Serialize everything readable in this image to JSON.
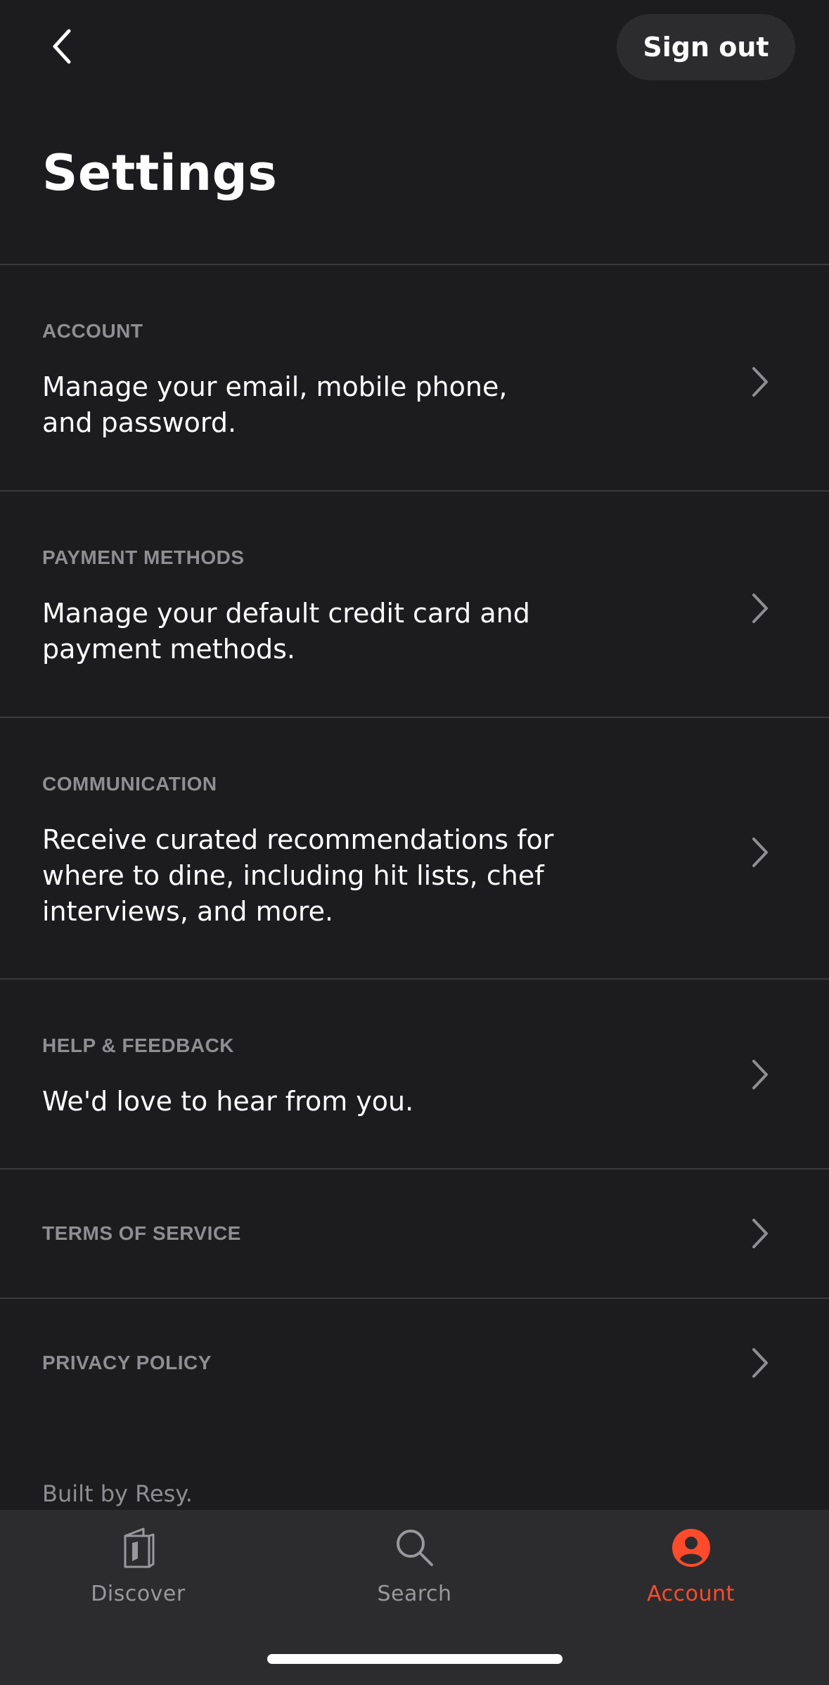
{
  "header": {
    "back_icon": "chevron-left-icon",
    "signout_label": "Sign out",
    "title": "Settings"
  },
  "settings": {
    "items": [
      {
        "label": "ACCOUNT",
        "description": "Manage your email, mobile phone, and password."
      },
      {
        "label": "PAYMENT METHODS",
        "description": "Manage your default credit card and payment methods."
      },
      {
        "label": "COMMUNICATION",
        "description": "Receive curated recommendations for where to dine, including hit lists, chef interviews, and more."
      },
      {
        "label": "HELP & FEEDBACK",
        "description": "We'd love to hear from you."
      },
      {
        "label": "TERMS OF SERVICE"
      },
      {
        "label": "PRIVACY POLICY"
      }
    ],
    "chevron_icon": "chevron-right-icon"
  },
  "footer": {
    "text": "Built by Resy."
  },
  "tab_bar": {
    "tabs": [
      {
        "label": "Discover",
        "icon": "book-icon",
        "active": false
      },
      {
        "label": "Search",
        "icon": "search-icon",
        "active": false
      },
      {
        "label": "Account",
        "icon": "account-icon",
        "active": true
      }
    ]
  },
  "colors": {
    "background": "#1c1c1e",
    "tab_bar": "#2c2c2e",
    "divider": "#3a3a3c",
    "label_gray": "#8e8e93",
    "accent": "#ff4b2b",
    "text": "#ffffff"
  }
}
